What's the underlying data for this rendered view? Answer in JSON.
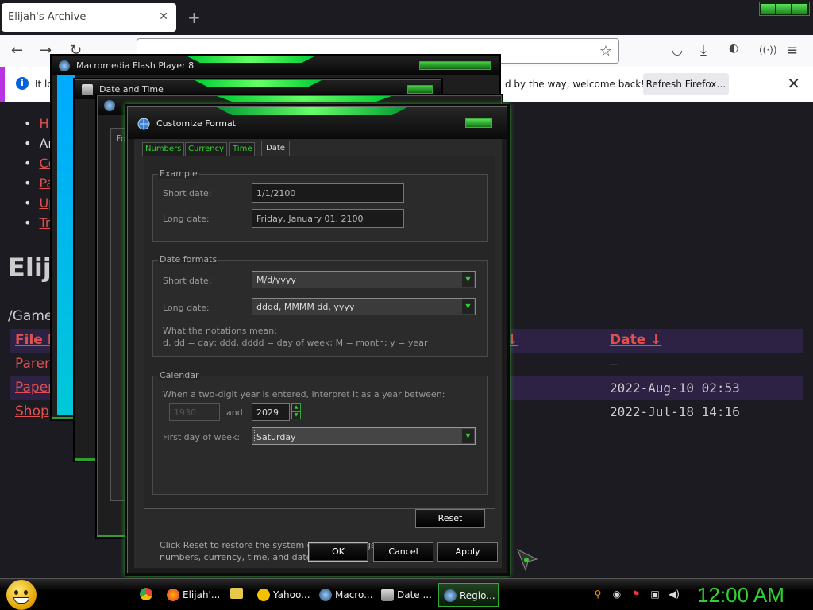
{
  "browser": {
    "tab_title": "Elijah's Archive",
    "tab_close": "✕",
    "new_tab": "+",
    "notification_left": "It lo",
    "notification_right": "d by the way, welcome back!",
    "refresh_button": "Refresh Firefox…",
    "notification_close": "✕"
  },
  "page": {
    "nav": [
      "H",
      "Ar",
      "Co",
      "Pa",
      "Up",
      "Tr"
    ],
    "title": "Elija",
    "breadcrumb": "/Game",
    "table": {
      "head_file": "File N",
      "head_arrow": "↓",
      "head_date": "Date ↓",
      "rows": [
        {
          "name": "Paren",
          "date": "–"
        },
        {
          "name": "Paper",
          "date": "2022-Aug-10 02:53"
        },
        {
          "name": "Shopp",
          "date": "2022-Jul-18 14:16"
        }
      ]
    }
  },
  "windows": {
    "flash_title": "Macromedia Flash Player 8",
    "datetime_title": "Date and Time",
    "regional_tab_stub": "For"
  },
  "dialog": {
    "title": "Customize Format",
    "tabs": [
      "Numbers",
      "Currency",
      "Time",
      "Date"
    ],
    "active_tab": "Date",
    "example": {
      "legend": "Example",
      "short_label": "Short date:",
      "short_value": "1/1/2100",
      "long_label": "Long date:",
      "long_value": "Friday, January 01, 2100"
    },
    "formats": {
      "legend": "Date formats",
      "short_label": "Short date:",
      "short_value": "M/d/yyyy",
      "long_label": "Long date:",
      "long_value": "dddd, MMMM dd, yyyy",
      "notation_title": "What the notations mean:",
      "notation_text": "d, dd = day;  ddd, dddd = day of week;  M = month;  y = year"
    },
    "calendar": {
      "legend": "Calendar",
      "two_digit_label": "When a two-digit year is entered, interpret it as a year between:",
      "year_from": "1930",
      "and_label": "and",
      "year_to": "2029",
      "first_day_label": "First day of week:",
      "first_day_value": "Saturday"
    },
    "reset_note": "Click Reset to restore the system default settings for numbers, currency, time, and date.",
    "reset_button": "Reset",
    "ok_button": "OK",
    "cancel_button": "Cancel",
    "apply_button": "Apply"
  },
  "taskbar": {
    "items": [
      "Elijah'...",
      "Yahoo...",
      "Macro...",
      "Date ...",
      "Regio..."
    ],
    "clock": "12:00 AM"
  },
  "colors": {
    "accent_green": "#2fd12f",
    "link_red": "#e05050",
    "row_highlight": "#2e2244"
  }
}
